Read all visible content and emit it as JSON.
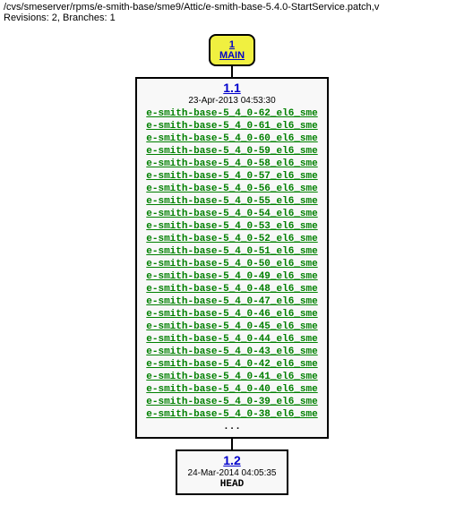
{
  "header": {
    "path": "/cvs/smeserver/rpms/e-smith-base/sme9/Attic/e-smith-base-5.4.0-StartService.patch,v",
    "revisions_line": "Revisions: 2, Branches: 1"
  },
  "main_branch": {
    "number": "1",
    "label": "MAIN"
  },
  "rev1": {
    "number": "1.1",
    "date": "23-Apr-2013 04:53:30",
    "tags": [
      "e-smith-base-5_4_0-62_el6_sme",
      "e-smith-base-5_4_0-61_el6_sme",
      "e-smith-base-5_4_0-60_el6_sme",
      "e-smith-base-5_4_0-59_el6_sme",
      "e-smith-base-5_4_0-58_el6_sme",
      "e-smith-base-5_4_0-57_el6_sme",
      "e-smith-base-5_4_0-56_el6_sme",
      "e-smith-base-5_4_0-55_el6_sme",
      "e-smith-base-5_4_0-54_el6_sme",
      "e-smith-base-5_4_0-53_el6_sme",
      "e-smith-base-5_4_0-52_el6_sme",
      "e-smith-base-5_4_0-51_el6_sme",
      "e-smith-base-5_4_0-50_el6_sme",
      "e-smith-base-5_4_0-49_el6_sme",
      "e-smith-base-5_4_0-48_el6_sme",
      "e-smith-base-5_4_0-47_el6_sme",
      "e-smith-base-5_4_0-46_el6_sme",
      "e-smith-base-5_4_0-45_el6_sme",
      "e-smith-base-5_4_0-44_el6_sme",
      "e-smith-base-5_4_0-43_el6_sme",
      "e-smith-base-5_4_0-42_el6_sme",
      "e-smith-base-5_4_0-41_el6_sme",
      "e-smith-base-5_4_0-40_el6_sme",
      "e-smith-base-5_4_0-39_el6_sme",
      "e-smith-base-5_4_0-38_el6_sme"
    ],
    "ellipsis": "..."
  },
  "rev2": {
    "number": "1.2",
    "date": "24-Mar-2014 04:05:35",
    "head": "HEAD"
  }
}
